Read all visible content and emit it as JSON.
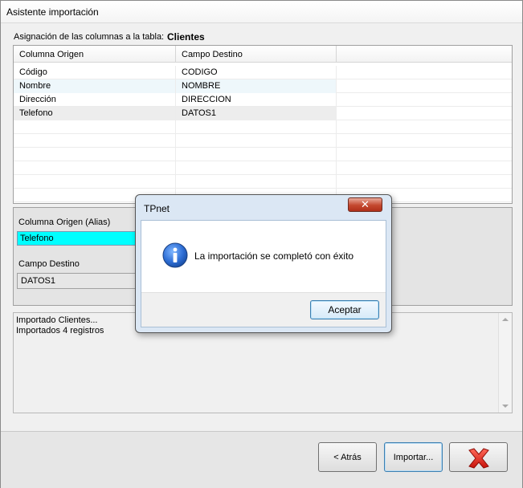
{
  "window": {
    "title": "Asistente importación"
  },
  "header": {
    "label": "Asignación de las columnas a la tabla:",
    "table_name": "Clientes"
  },
  "grid": {
    "columns": [
      "Columna Origen",
      "Campo Destino",
      ""
    ],
    "rows": [
      [
        "Código",
        "CODIGO"
      ],
      [
        "Nombre",
        "NOMBRE"
      ],
      [
        "Dirección",
        "DIRECCION"
      ],
      [
        "Telefono",
        "DATOS1"
      ]
    ]
  },
  "mapping": {
    "alias_label": "Columna Origen (Alias)",
    "alias_value": "Telefono",
    "dest_label": "Campo Destino",
    "dest_value": "DATOS1"
  },
  "log": {
    "lines": [
      "Importado Clientes...",
      "Importados 4 registros"
    ]
  },
  "footer": {
    "back_label": "< Atrás",
    "import_label": "Importar..."
  },
  "dialog": {
    "title": "TPnet",
    "message": "La importación se completó con éxito",
    "ok_label": "Aceptar",
    "close_glyph": "✕"
  },
  "colors": {
    "alias_highlight": "#00ffff",
    "accent_blue": "#3c7fb1",
    "close_red": "#c4482f"
  }
}
